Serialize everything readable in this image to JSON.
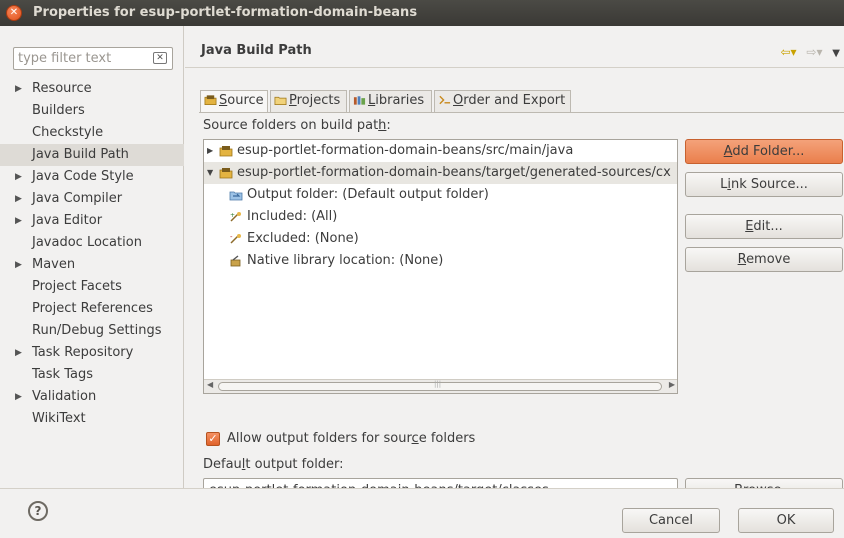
{
  "window": {
    "title": "Properties for esup-portlet-formation-domain-beans"
  },
  "filter": {
    "placeholder": "type filter text"
  },
  "nav": {
    "items": [
      {
        "label": "Resource",
        "arrow": true
      },
      {
        "label": "Builders",
        "arrow": false
      },
      {
        "label": "Checkstyle",
        "arrow": false
      },
      {
        "label": "Java Build Path",
        "arrow": false,
        "selected": true
      },
      {
        "label": "Java Code Style",
        "arrow": true
      },
      {
        "label": "Java Compiler",
        "arrow": true
      },
      {
        "label": "Java Editor",
        "arrow": true
      },
      {
        "label": "Javadoc Location",
        "arrow": false
      },
      {
        "label": "Maven",
        "arrow": true
      },
      {
        "label": "Project Facets",
        "arrow": false
      },
      {
        "label": "Project References",
        "arrow": false
      },
      {
        "label": "Run/Debug Settings",
        "arrow": false
      },
      {
        "label": "Task Repository",
        "arrow": true
      },
      {
        "label": "Task Tags",
        "arrow": false
      },
      {
        "label": "Validation",
        "arrow": true
      },
      {
        "label": "WikiText",
        "arrow": false
      }
    ]
  },
  "page": {
    "title": "Java Build Path"
  },
  "tabs": {
    "source": {
      "pre": "",
      "u": "S",
      "post": "ource"
    },
    "projects": {
      "pre": "",
      "u": "P",
      "post": "rojects"
    },
    "libraries": {
      "pre": "",
      "u": "L",
      "post": "ibraries"
    },
    "order": {
      "pre": "",
      "u": "O",
      "post": "rder and Export"
    }
  },
  "source_section": {
    "pre": "Source folders on build pat",
    "u": "h",
    "post": ":"
  },
  "tree": {
    "rows": [
      "esup-portlet-formation-domain-beans/src/main/java",
      "esup-portlet-formation-domain-beans/target/generated-sources/cx",
      "Output folder: (Default output folder)",
      "Included: (All)",
      "Excluded: (None)",
      "Native library location: (None)"
    ],
    "scroll_grip": "|||"
  },
  "buttons": {
    "add_folder": {
      "pre": "",
      "u": "A",
      "post": "dd Folder..."
    },
    "link_source": {
      "pre": "L",
      "u": "i",
      "post": "nk Source..."
    },
    "edit": {
      "pre": "",
      "u": "E",
      "post": "dit..."
    },
    "remove": {
      "pre": "",
      "u": "R",
      "post": "emove"
    },
    "browse": {
      "pre": "Bro",
      "u": "w",
      "post": "se..."
    },
    "cancel": "Cancel",
    "ok": "OK"
  },
  "allow_output": {
    "pre": "Allow output folders for sour",
    "u": "c",
    "post": "e folders",
    "checked": true
  },
  "default_output": {
    "pre": "Defau",
    "u": "l",
    "post": "t output folder:",
    "value": "esup-portlet-formation-domain-beans/target/classes"
  },
  "footer": {
    "help": "?"
  },
  "colors": {
    "accent": "#ea7f4c",
    "titlebar": "#3c3b37"
  },
  "icons": [
    "close-icon",
    "clear-filter-icon",
    "back-arrow-icon",
    "forward-arrow-icon",
    "view-menu-icon",
    "source-folder-icon",
    "project-icon",
    "library-icon",
    "order-icon",
    "output-folder-icon",
    "included-icon",
    "excluded-icon",
    "native-library-icon",
    "help-icon"
  ]
}
